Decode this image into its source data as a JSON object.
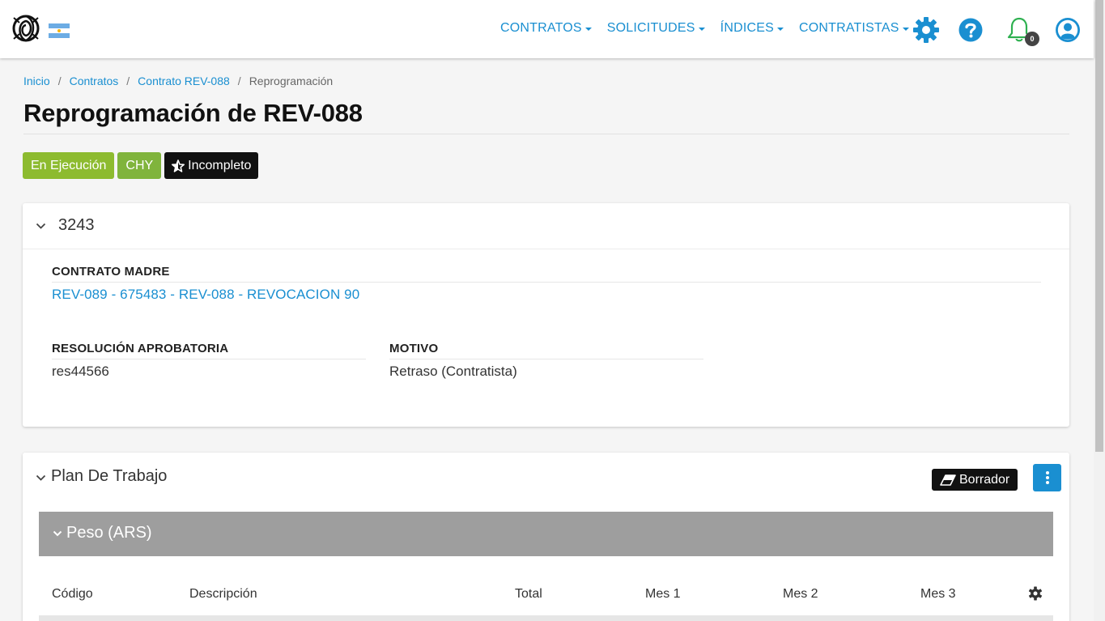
{
  "nav": {
    "items": [
      {
        "label": "CONTRATOS"
      },
      {
        "label": "SOLICITUDES"
      },
      {
        "label": "ÍNDICES"
      },
      {
        "label": "CONTRATISTAS"
      }
    ],
    "notification_count": "0",
    "icons": [
      "gear-icon",
      "help-icon",
      "bell-icon",
      "user-icon"
    ],
    "accent_color": "#1a8fd1"
  },
  "breadcrumb": {
    "items": [
      "Inicio",
      "Contratos",
      "Contrato REV-088"
    ],
    "current": "Reprogramación"
  },
  "page": {
    "title": "Reprogramación de REV-088"
  },
  "badges": {
    "status": "En Ejecución",
    "currency": "CHY",
    "completeness": "Incompleto"
  },
  "summary_card": {
    "title": "3243",
    "contrato_madre_label": "CONTRATO MADRE",
    "contrato_madre_value": "REV-089 - 675483 - REV-088 - REVOCACION 90",
    "resolucion_label": "RESOLUCIÓN APROBATORIA",
    "resolucion_value": "res44566",
    "motivo_label": "MOTIVO",
    "motivo_value": "Retraso (Contratista)"
  },
  "plan_card": {
    "title": "Plan De Trabajo",
    "draft_label": "Borrador",
    "section_title": "Peso (ARS)",
    "columns": [
      "Código",
      "Descripción",
      "Total",
      "Mes 1",
      "Mes 2",
      "Mes 3"
    ]
  }
}
